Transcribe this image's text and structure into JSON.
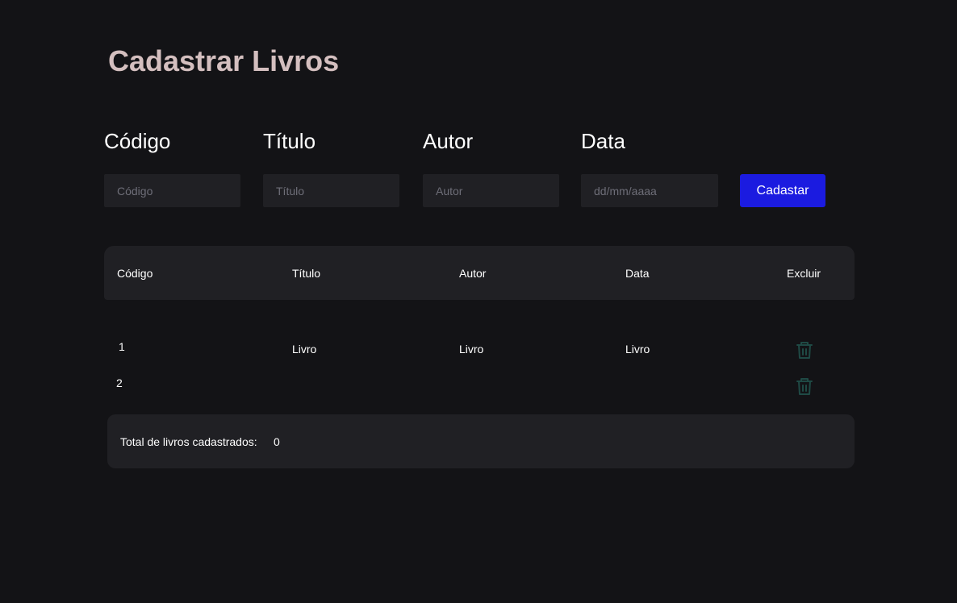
{
  "page": {
    "title": "Cadastrar Livros"
  },
  "form": {
    "fields": [
      {
        "label": "Código",
        "placeholder": "Código",
        "value": ""
      },
      {
        "label": "Título",
        "placeholder": "Título",
        "value": ""
      },
      {
        "label": "Autor",
        "placeholder": "Autor",
        "value": ""
      },
      {
        "label": "Data",
        "placeholder": "dd/mm/aaaa",
        "value": ""
      }
    ],
    "submit_label": "Cadastar"
  },
  "table": {
    "headers": [
      "Código",
      "Título",
      "Autor",
      "Data",
      "Excluir"
    ],
    "rows": [
      {
        "codigo": "1",
        "titulo": "Livro",
        "autor": "Livro",
        "data": "Livro",
        "delete_icon": "trash-icon"
      },
      {
        "codigo": "2",
        "titulo": "",
        "autor": "",
        "data": "",
        "delete_icon": "trash-icon"
      }
    ]
  },
  "footer": {
    "total_label": "Total de livros cadastrados:",
    "total_value": "0"
  },
  "colors": {
    "background": "#131316",
    "panel": "#202024",
    "title": "#d4bfbf",
    "accent": "#1b1be0",
    "icon": "#1f4a45"
  }
}
